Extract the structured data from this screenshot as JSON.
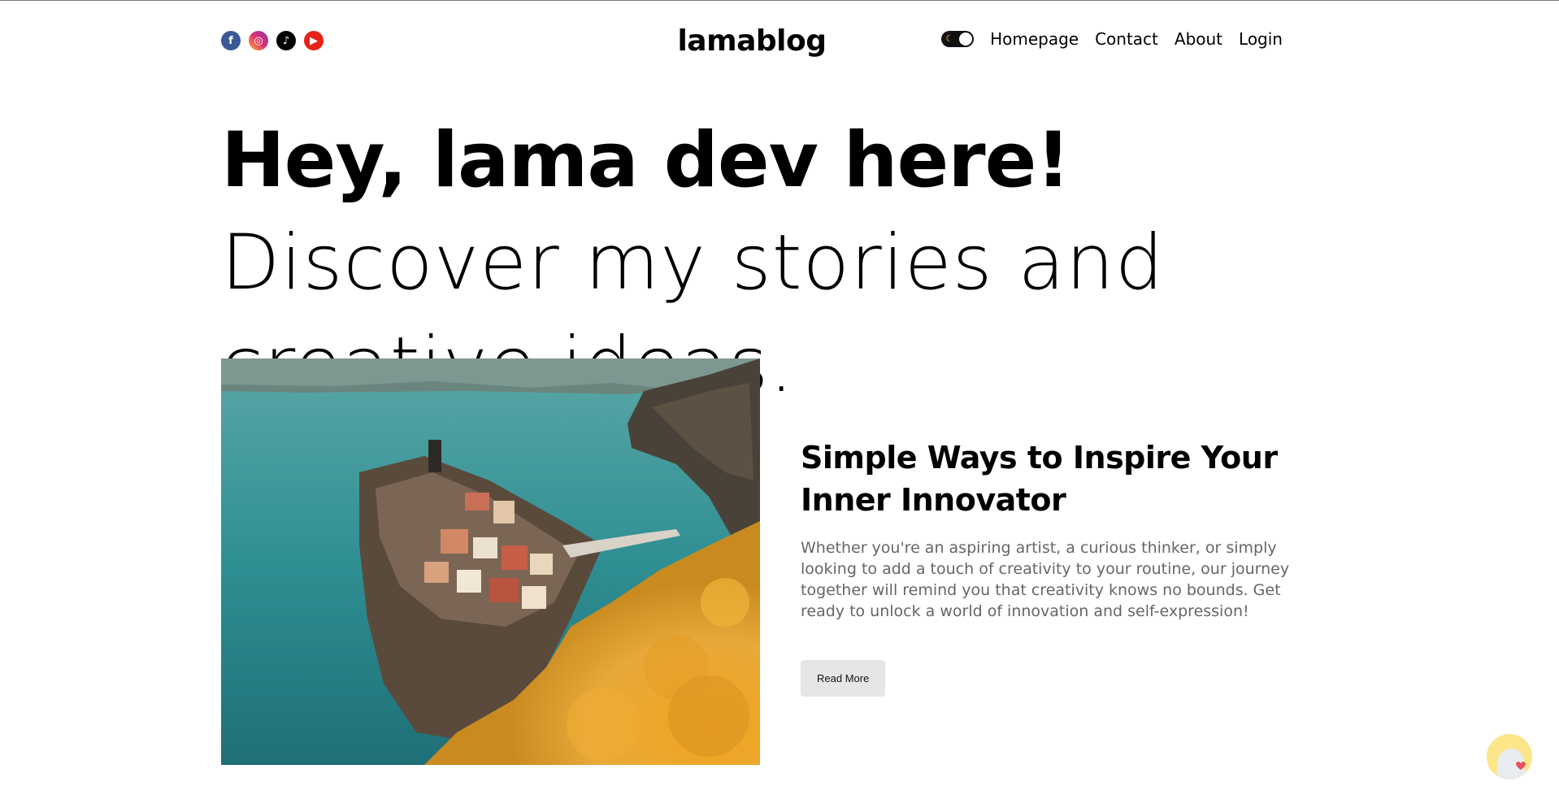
{
  "header": {
    "logo": "lamablog",
    "socials": [
      {
        "name": "facebook-icon",
        "glyph": "f"
      },
      {
        "name": "instagram-icon",
        "glyph": "◎"
      },
      {
        "name": "tiktok-icon",
        "glyph": "♪"
      },
      {
        "name": "youtube-icon",
        "glyph": "▶"
      }
    ],
    "nav": {
      "homepage": "Homepage",
      "contact": "Contact",
      "about": "About",
      "login": "Login"
    },
    "theme_toggle": {
      "state": "dark",
      "icon": "moon-icon"
    }
  },
  "hero": {
    "bold": "Hey, lama dev here!",
    "rest": " Discover my stories and creative ideas."
  },
  "featured": {
    "image_icon": "coastal-village-image",
    "title": "Simple Ways to Inspire Your Inner Innovator",
    "description": "Whether you're an aspiring artist, a curious thinker, or simply looking to add a touch of creativity to your routine, our journey together will remind you that creativity knows no bounds. Get ready to unlock a world of innovation and self-expression!",
    "button": "Read More"
  },
  "colors": {
    "background": "#ffffff",
    "text": "#000000",
    "muted_text": "#666666",
    "button_bg": "#e6e6e6"
  }
}
